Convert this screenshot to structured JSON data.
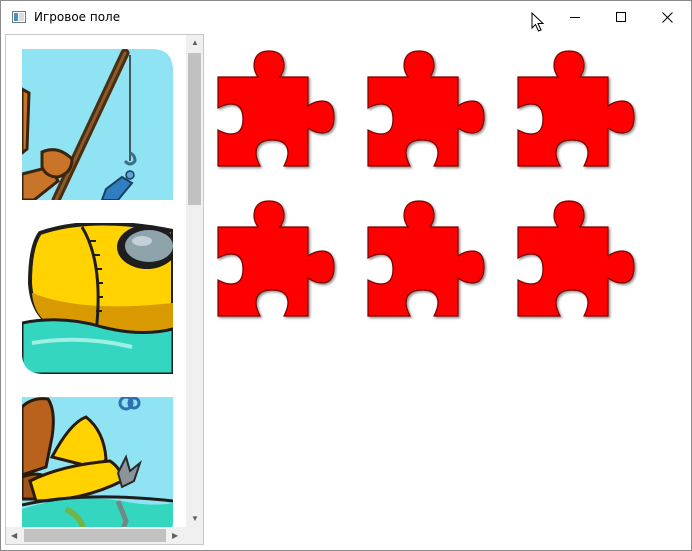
{
  "window": {
    "title": "Игровое поле",
    "controls": [
      "minimize-icon",
      "maximize-icon",
      "close-icon"
    ]
  },
  "piece_tray": {
    "tiles": [
      {
        "name": "fishing-rod-piece"
      },
      {
        "name": "yellow-submarine-piece"
      },
      {
        "name": "diver-boat-piece"
      }
    ]
  },
  "board": {
    "rows": 2,
    "columns": 3,
    "slot_color": "#ff0000",
    "empty_slots": 6
  },
  "colors": {
    "sky": "#8fe3f2",
    "water": "#35d6c0",
    "yellow": "#ffd200",
    "piece_red": "#ff0000"
  }
}
